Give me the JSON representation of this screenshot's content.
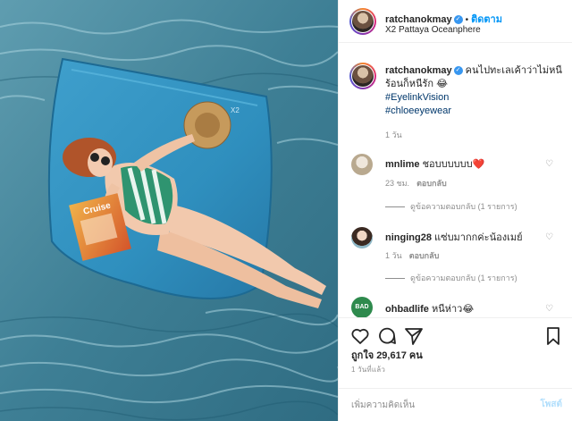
{
  "post": {
    "author": "ratchanokmay",
    "follow_label": "ติดตาม",
    "location": "X2 Pattaya Oceanphere",
    "caption": "คนไปทะเลเค้าว่าไม่หนีร้อนก็หนีรัก 😂",
    "hashtags": [
      "#EyelinkVision",
      "#chloeeyewear"
    ],
    "age": "1 วัน",
    "likes_text": "ถูกใจ 29,617 คน",
    "date_text": "1 วันที่แล้ว"
  },
  "photo": {
    "pillow_label": "X2",
    "magazine_title": "Cruise"
  },
  "comments": [
    {
      "username": "mnlime",
      "text": "ชอบบบบบบ❤️",
      "age": "23 ชม.",
      "reply_label": "ตอบกลับ",
      "view_replies": "ดูข้อความตอบกลับ (1 รายการ)"
    },
    {
      "username": "ninging28",
      "text": "แซ่บมากกค่ะน้องเมย์",
      "age": "1 วัน",
      "reply_label": "ตอบกลับ",
      "view_replies": "ดูข้อความตอบกลับ (1 รายการ)"
    },
    {
      "username": "ohbadlife",
      "text": "หนีห่าว😂",
      "avatar_text": "BAD"
    }
  ],
  "composer": {
    "placeholder": "เพิ่มความคิดเห็น",
    "post_label": "โพสต์"
  },
  "icons": {
    "verified": "verified-badge-icon",
    "heart": "heart-icon",
    "comment": "comment-icon",
    "share": "paper-plane-icon",
    "save": "bookmark-icon"
  }
}
